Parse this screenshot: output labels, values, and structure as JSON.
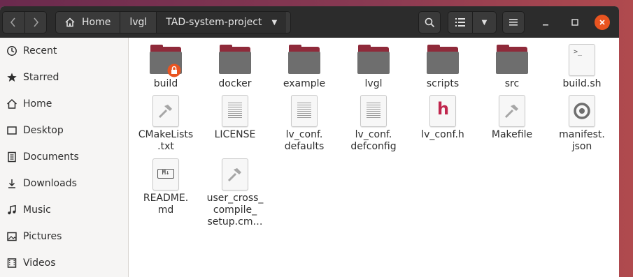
{
  "headerbar": {
    "breadcrumbs": [
      {
        "label": "Home",
        "icon": "home-icon"
      },
      {
        "label": "lvgl"
      },
      {
        "label": "TAD-system-project",
        "active": true
      }
    ]
  },
  "sidebar": {
    "items": [
      {
        "label": "Recent",
        "icon": "clock-icon"
      },
      {
        "label": "Starred",
        "icon": "star-icon"
      },
      {
        "label": "Home",
        "icon": "home-icon"
      },
      {
        "label": "Desktop",
        "icon": "desktop-icon"
      },
      {
        "label": "Documents",
        "icon": "document-icon"
      },
      {
        "label": "Downloads",
        "icon": "download-icon"
      },
      {
        "label": "Music",
        "icon": "music-icon"
      },
      {
        "label": "Pictures",
        "icon": "picture-icon"
      },
      {
        "label": "Videos",
        "icon": "video-icon"
      }
    ]
  },
  "files": [
    {
      "name": "build",
      "kind": "folder-locked"
    },
    {
      "name": "docker",
      "kind": "folder"
    },
    {
      "name": "example",
      "kind": "folder"
    },
    {
      "name": "lvgl",
      "kind": "folder"
    },
    {
      "name": "scripts",
      "kind": "folder"
    },
    {
      "name": "src",
      "kind": "folder"
    },
    {
      "name": "build.sh",
      "kind": "script"
    },
    {
      "name": "CMakeLists\n.txt",
      "kind": "makefile"
    },
    {
      "name": "LICENSE",
      "kind": "text"
    },
    {
      "name": "lv_conf.\ndefaults",
      "kind": "text"
    },
    {
      "name": "lv_conf.\ndefconfig",
      "kind": "text"
    },
    {
      "name": "lv_conf.h",
      "kind": "header"
    },
    {
      "name": "Makefile",
      "kind": "makefile"
    },
    {
      "name": "manifest.\njson",
      "kind": "json"
    },
    {
      "name": "README.\nmd",
      "kind": "markdown"
    },
    {
      "name": "user_cross_\ncompile_\nsetup.cm…",
      "kind": "makefile"
    }
  ],
  "colors": {
    "accent": "#e95420",
    "folder_tab": "#8f2a3a",
    "folder_body": "#6e6e6e",
    "header_letter": "#c0264d"
  }
}
